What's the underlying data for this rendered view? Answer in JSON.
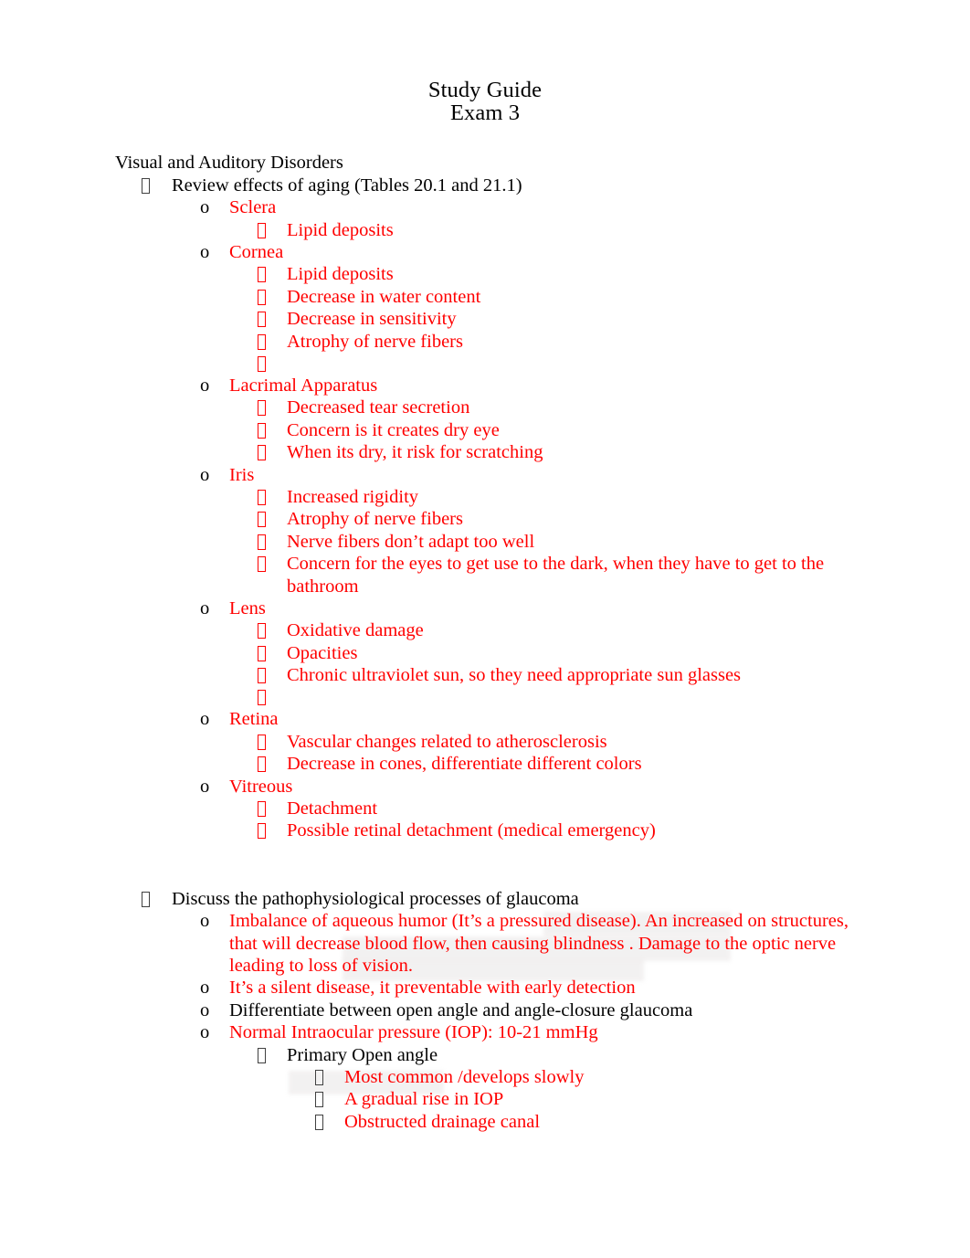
{
  "document": {
    "title_line_1": "Study Guide",
    "title_line_2": "Exam 3",
    "heading": "Visual and Auditory Disorders"
  },
  "colors": {
    "red": "#ff0000",
    "black": "#000000",
    "bullet_box": "#404040",
    "shading": "#e9e6e6"
  },
  "icons": {
    "level1_bullet": "missing-glyph-box",
    "level2_bullet": "letter-o",
    "level3_bullet": "missing-glyph-box",
    "level4_bullet": "missing-glyph-box"
  },
  "sections": {
    "aging": {
      "heading": "Review effects of aging (Tables 20.1 and 21.1)",
      "items": [
        {
          "name": "Sclera",
          "subs": [
            "Lipid deposits"
          ]
        },
        {
          "name": "Cornea",
          "subs": [
            "Lipid deposits",
            "Decrease in water content",
            "Decrease in sensitivity",
            "Atrophy of nerve fibers",
            ""
          ]
        },
        {
          "name": "Lacrimal Apparatus",
          "subs": [
            "Decreased tear secretion",
            "Concern is it creates dry eye",
            "When its dry, it risk for scratching"
          ]
        },
        {
          "name": "Iris",
          "subs": [
            "Increased rigidity",
            "Atrophy of nerve fibers",
            "Nerve fibers don’t adapt too well",
            "Concern for the eyes to get use to the dark, when they have to get to the bathroom"
          ]
        },
        {
          "name": "Lens",
          "subs": [
            "Oxidative damage",
            "Opacities",
            "Chronic ultraviolet sun, so they need appropriate sun glasses",
            ""
          ]
        },
        {
          "name": "Retina",
          "subs": [
            "Vascular changes related to atherosclerosis",
            "Decrease in cones, differentiate different colors"
          ]
        },
        {
          "name": "Vitreous",
          "subs": [
            "Detachment",
            "Possible retinal detachment (medical emergency)"
          ]
        }
      ]
    },
    "glaucoma": {
      "heading": "Discuss the pathophysiological processes of glaucoma",
      "point_1": "Imbalance of aqueous humor (It’s a pressured disease).   An increased on structures, that will decrease blood flow, then causing blindness    . Damage to the optic nerve leading to loss of vision.",
      "point_2": "It’s a silent disease, it preventable with early detection",
      "point_3": "Differentiate between open angle and angle-closure glaucoma",
      "point_4": "Normal Intraocular pressure (IOP): 10-21 mmHg",
      "primary_open_angle": {
        "label": "Primary Open angle",
        "subs": [
          "Most common /develops slowly",
          "A gradual rise in IOP",
          "Obstructed drainage canal"
        ]
      }
    }
  }
}
